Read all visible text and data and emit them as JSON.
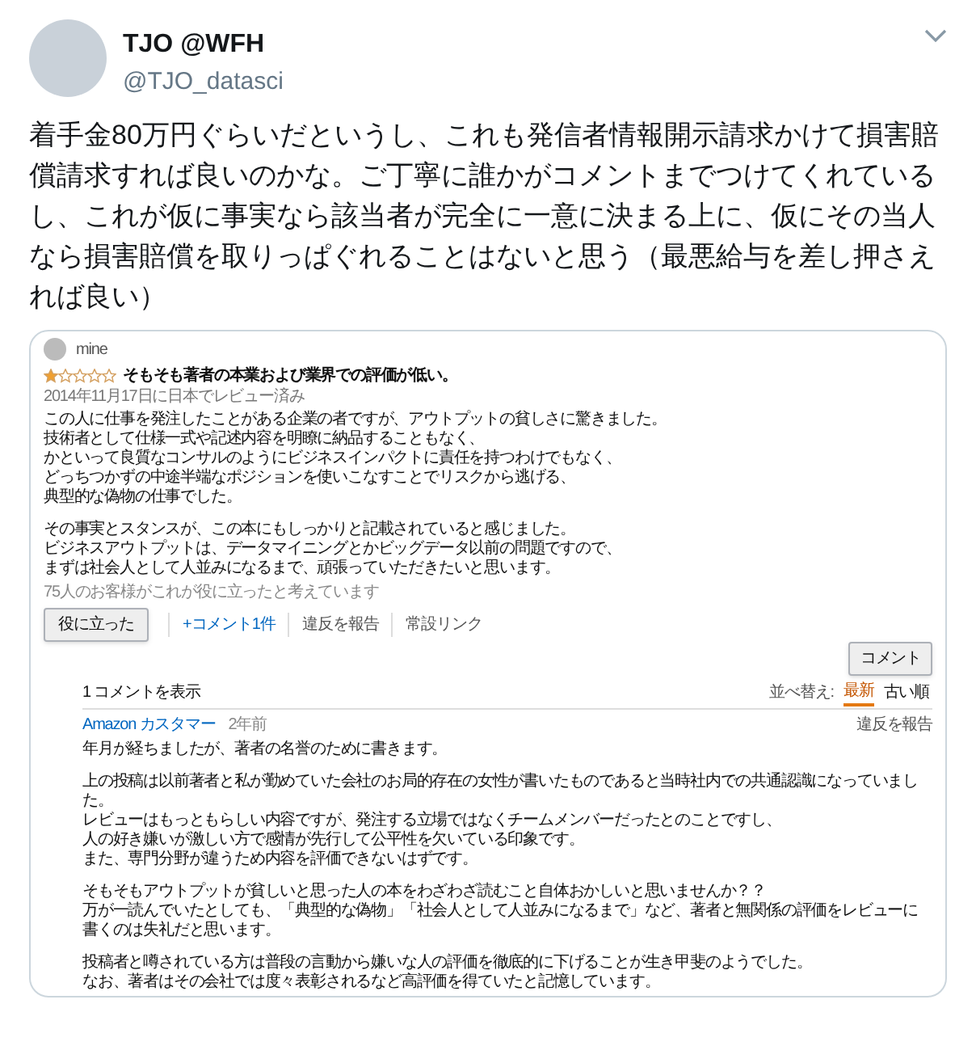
{
  "tweet": {
    "name": "TJO @WFH",
    "handle": "@TJO_datasci",
    "text": "着手金80万円ぐらいだというし、これも発信者情報開示請求かけて損害賠償請求すれば良いのかな。ご丁寧に誰かがコメントまでつけてくれているし、これが仮に事実なら該当者が完全に一意に決まる上に、仮にその当人なら損害賠償を取りっぱぐれることはないと思う（最悪給与を差し押さえれば良い）"
  },
  "review": {
    "reviewer": "mine",
    "stars": 1,
    "title": "そもそも著者の本業および業界での評価が低い。",
    "date": "2014年11月17日に日本でレビュー済み",
    "paragraphs": [
      [
        "この人に仕事を発注したことがある企業の者ですが、アウトプットの貧しさに驚きました。",
        "技術者として仕様一式や記述内容を明瞭に納品することもなく、",
        "かといって良質なコンサルのようにビジネスインパクトに責任を持つわけでもなく、",
        "どっちつかずの中途半端なポジションを使いこなすことでリスクから逃げる、",
        "典型的な偽物の仕事でした。"
      ],
      [
        "その事実とスタンスが、この本にもしっかりと記載されていると感じました。",
        "ビジネスアウトプットは、データマイニングとかビッグデータ以前の問題ですので、",
        "まずは社会人として人並みになるまで、頑張っていただきたいと思います。"
      ]
    ],
    "helpful_count": "75人のお客様がこれが役に立ったと考えています"
  },
  "actions": [
    {
      "kind": "button",
      "label": "役に立った"
    },
    {
      "kind": "link",
      "label": "+コメント1件"
    },
    {
      "kind": "plain",
      "label": "違反を報告"
    },
    {
      "kind": "plain",
      "label": "常設リンク"
    }
  ],
  "comment_button": "コメント",
  "comments_header": "1 コメントを表示",
  "sort_label": "並べ替え:",
  "sort_options": [
    {
      "label": "最新",
      "selected": true
    },
    {
      "label": "古い順",
      "selected": false
    }
  ],
  "comment": {
    "author": "Amazon カスタマー",
    "age": "2年前",
    "report": "違反を報告",
    "paragraphs": [
      [
        "年月が経ちましたが、著者の名誉のために書きます。"
      ],
      [
        "上の投稿は以前著者と私が勤めていた会社のお局的存在の女性が書いたものであると当時社内での共通認識になっていました。",
        "レビューはもっともらしい内容ですが、発注する立場ではなくチームメンバーだったとのことですし、",
        "人の好き嫌いが激しい方で感情が先行して公平性を欠いている印象です。",
        "また、専門分野が違うため内容を評価できないはずです。"
      ],
      [
        "そもそもアウトプットが貧しいと思った人の本をわざわざ読むこと自体おかしいと思いませんか？？",
        "万が一読んでいたとしても、「典型的な偽物」「社会人として人並みになるまで」など、著者と無関係の評価をレビューに書くのは失礼だと思います。"
      ],
      [
        "投稿者と噂されている方は普段の言動から嫌いな人の評価を徹底的に下げることが生き甲斐のようでした。",
        "なお、著者はその会社では度々表彰されるなど高評価を得ていたと記憶しています。"
      ]
    ]
  }
}
